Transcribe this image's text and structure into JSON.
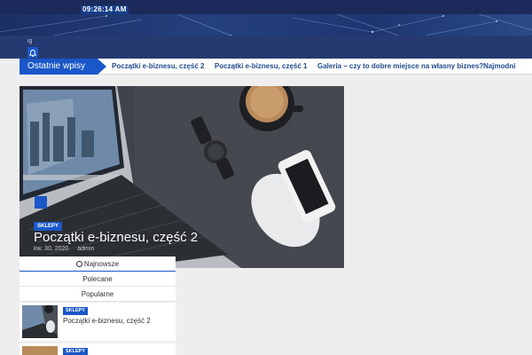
{
  "topbar": {
    "time": "09:26:14 AM"
  },
  "nav": {
    "ig_text": "ig",
    "bell_icon": "bell-icon"
  },
  "ticker": {
    "label": "Ostatnie wpisy",
    "items": [
      "Początki e-biznesu, część 2",
      "Początki e-biznesu, część 1",
      "Galeria – czy to dobre miejsce na własny biznes?",
      "Najmodni"
    ]
  },
  "hero": {
    "category": "SKLEPY",
    "title": "Początki e-biznesu, część 2",
    "date": "kw. 30, 2020",
    "author": "admin"
  },
  "tabs": {
    "latest": "Najnowsze",
    "recommended": "Polecane",
    "popular": "Popularne"
  },
  "posts": [
    {
      "category": "SKLEPY",
      "title": "Początki e-biznesu, część 2"
    },
    {
      "category": "SKLEPY"
    }
  ],
  "colors": {
    "accent": "#1a57c8",
    "header_dark": "#1b2a5a"
  }
}
